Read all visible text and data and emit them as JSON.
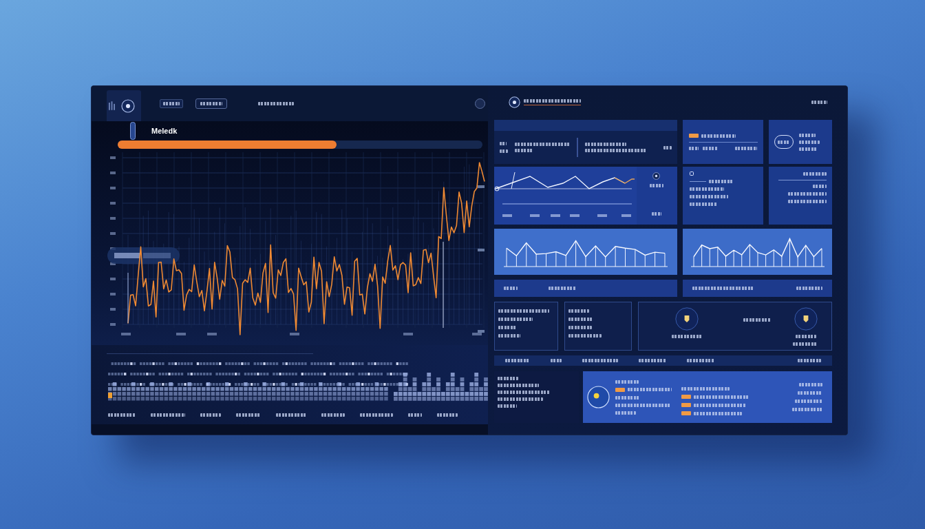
{
  "chart_panel": {
    "title": "Meledk",
    "progress": {
      "level": 0.6
    }
  }
}
